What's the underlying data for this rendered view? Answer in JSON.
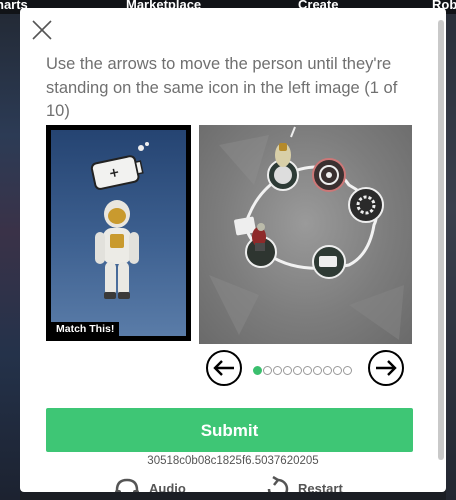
{
  "background": {
    "nav": [
      "harts",
      "Marketplace",
      "Create",
      "Rob"
    ]
  },
  "modal": {
    "instruction": "Use the arrows to move the person until they're standing on the same icon in the left image (1 of 10)",
    "match_label": "Match This!",
    "pagination": {
      "current": 1,
      "total": 10
    },
    "submit_label": "Submit",
    "session_id": "30518c0b08c1825f6.5037620205",
    "audio_label": "Audio",
    "restart_label": "Restart"
  },
  "colors": {
    "accent": "#3ec675",
    "dot_active": "#3bbf6e",
    "text": "#707070"
  },
  "icons": {
    "close": "close-icon",
    "prev": "arrow-left-icon",
    "next": "arrow-right-icon",
    "audio": "headphones-icon",
    "restart": "restart-icon"
  }
}
